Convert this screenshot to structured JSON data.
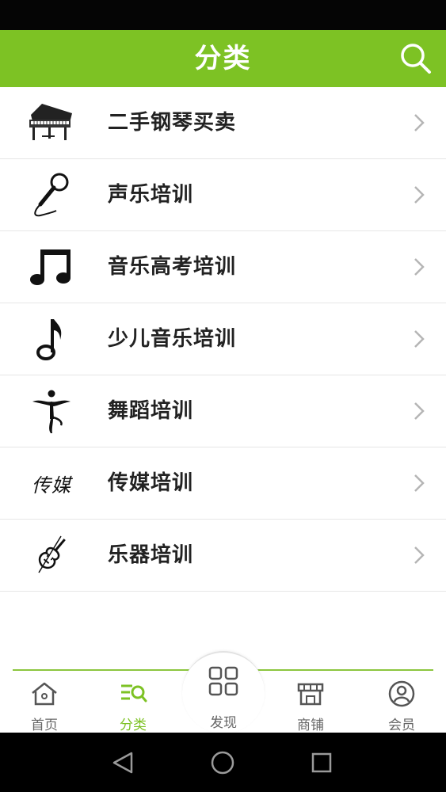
{
  "header": {
    "title": "分类",
    "search_icon": "search-icon"
  },
  "categories": [
    {
      "label": "二手钢琴买卖",
      "icon": "piano-icon"
    },
    {
      "label": "声乐培训",
      "icon": "microphone-icon"
    },
    {
      "label": "音乐高考培训",
      "icon": "beamed-notes-icon"
    },
    {
      "label": "少儿音乐培训",
      "icon": "eighth-note-icon"
    },
    {
      "label": "舞蹈培训",
      "icon": "dancer-icon"
    },
    {
      "label": "传媒培训",
      "icon": "media-calligraphy-icon",
      "icon_text": "传媒"
    },
    {
      "label": "乐器培训",
      "icon": "violin-icon"
    }
  ],
  "tabbar": {
    "tabs": [
      {
        "label": "首页",
        "icon": "home-icon"
      },
      {
        "label": "分类",
        "icon": "category-icon",
        "active": true
      },
      {
        "label": "发现",
        "icon": "grid-icon"
      },
      {
        "label": "商铺",
        "icon": "shop-icon"
      },
      {
        "label": "会员",
        "icon": "user-icon"
      }
    ]
  },
  "colors": {
    "brand_green": "#7dc224",
    "tab_inactive": "#666666",
    "text_dark": "#222222"
  },
  "system_nav": {
    "back": "back-triangle-icon",
    "home": "home-circle-icon",
    "recents": "recents-square-icon"
  }
}
